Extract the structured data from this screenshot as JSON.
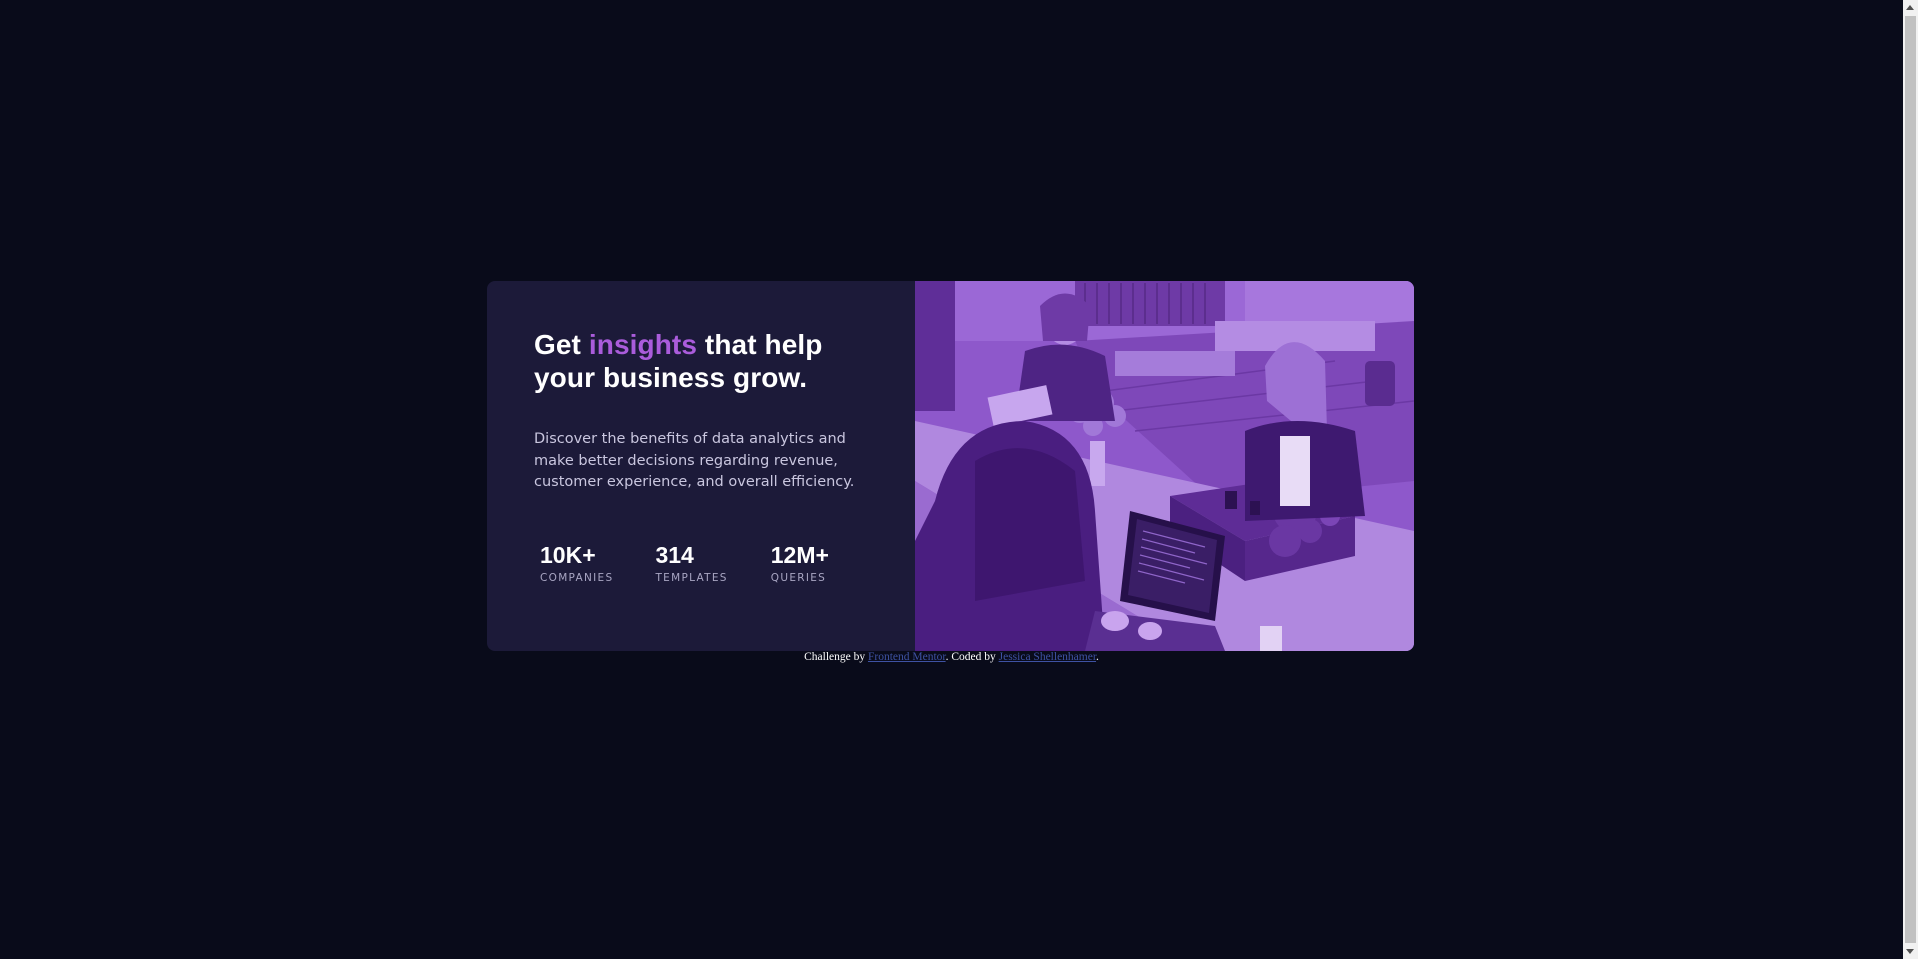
{
  "card": {
    "headline_before": "Get",
    "headline_accent": "insights",
    "headline_after": "that help your business grow.",
    "description": "Discover the benefits of data analytics and make better decisions regarding revenue, customer experience, and overall efficiency.",
    "stats": [
      {
        "value": "10K+",
        "label": "COMPANIES"
      },
      {
        "value": "314",
        "label": "TEMPLATES"
      },
      {
        "value": "12M+",
        "label": "QUERIES"
      }
    ],
    "image_icon": "office-team-photo-icon"
  },
  "attribution": {
    "prefix": "Challenge by",
    "link1": "Frontend Mentor",
    "middle": ". Coded by",
    "link2": "Jessica Shellenhamer",
    "suffix": "."
  },
  "colors": {
    "page_bg": "#090B1A",
    "card_bg": "#1C1A39",
    "accent": "#AA5CDB",
    "image_tint": "#8B55C7",
    "link": "#3E52A3"
  }
}
